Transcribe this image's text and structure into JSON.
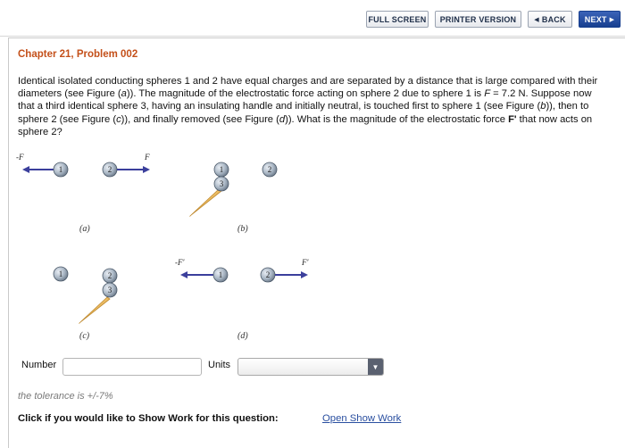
{
  "nav": {
    "full_screen": "FULL SCREEN",
    "printer_version": "PRINTER VERSION",
    "back": "BACK",
    "next": "NEXT"
  },
  "chapter_title": "Chapter 21, Problem 002",
  "problem_parts": [
    "Identical isolated conducting spheres 1 and 2 have equal charges and are separated by a distance that is large compared with their diameters (see Figure (",
    "a",
    ")). The magnitude of the electrostatic force acting on sphere 2 due to sphere 1 is ",
    "F",
    " = 7.2 N. Suppose now that a third identical sphere 3, having an insulating handle and initially neutral, is touched first to sphere 1 (see Figure (",
    "b",
    ")), then to sphere 2 (see Figure (",
    "c",
    ")), and finally removed (see Figure (",
    "d",
    ")). What is the magnitude of the electrostatic force ",
    "F'",
    " that now acts on sphere 2?"
  ],
  "figure": {
    "labels": {
      "neg_F": "-F",
      "F": "F",
      "neg_F_prime": "-F'",
      "F_prime": "F'"
    },
    "spheres": [
      "1",
      "2",
      "3"
    ],
    "captions": [
      "(a)",
      "(b)",
      "(c)",
      "(d)"
    ]
  },
  "answer": {
    "number_label": "Number",
    "number_value": "",
    "units_label": "Units",
    "units_value": ""
  },
  "tolerance": "the tolerance is +/-7%",
  "show_work_prompt": "Click if you would like to Show Work for this question:",
  "show_work_link": "Open Show Work",
  "colors": {
    "chapter_title": "#c4501a",
    "arrow": "#3b3f9c",
    "sphere_fill": "#9aa7b5",
    "handle": "#e8b04a",
    "link": "#2a4fa0"
  }
}
